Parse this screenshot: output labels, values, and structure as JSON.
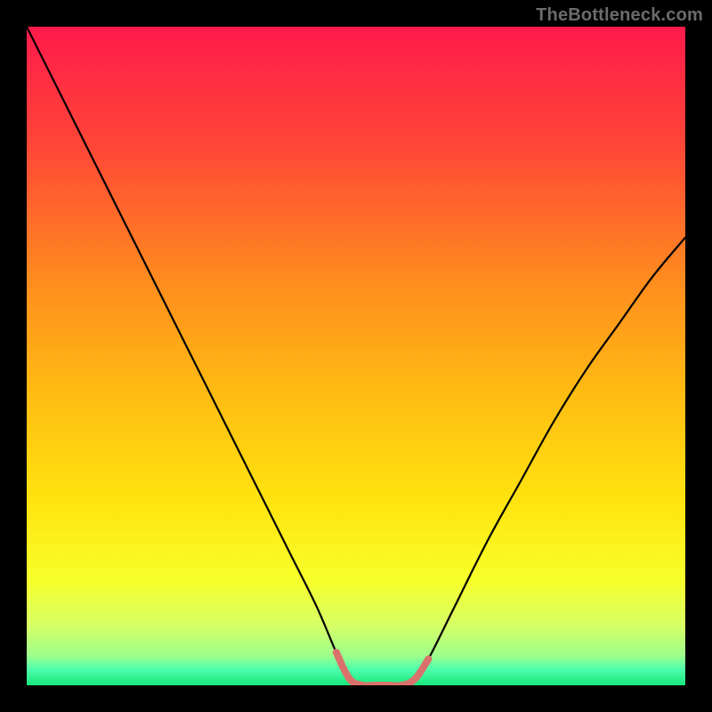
{
  "watermark": "TheBottleneck.com",
  "chart_data": {
    "type": "line",
    "title": "",
    "xlabel": "",
    "ylabel": "",
    "xlim": [
      0,
      100
    ],
    "ylim": [
      0,
      100
    ],
    "grid": false,
    "legend": false,
    "background_gradient": [
      {
        "stop": 0.0,
        "color": "#ff1a4b"
      },
      {
        "stop": 0.18,
        "color": "#ff4637"
      },
      {
        "stop": 0.38,
        "color": "#ff8a1f"
      },
      {
        "stop": 0.55,
        "color": "#ffba12"
      },
      {
        "stop": 0.72,
        "color": "#ffe30f"
      },
      {
        "stop": 0.84,
        "color": "#f7ff2a"
      },
      {
        "stop": 0.91,
        "color": "#d6ff66"
      },
      {
        "stop": 0.955,
        "color": "#9dff8c"
      },
      {
        "stop": 0.975,
        "color": "#4fffad"
      },
      {
        "stop": 1.0,
        "color": "#17e77b"
      }
    ],
    "series": [
      {
        "name": "bottleneck-curve",
        "stroke": "#000000",
        "x": [
          0,
          4,
          8,
          12,
          16,
          20,
          24,
          28,
          32,
          36,
          40,
          44,
          47,
          49,
          51,
          53,
          55,
          57,
          59,
          61,
          65,
          70,
          75,
          80,
          85,
          90,
          95,
          100
        ],
        "y": [
          100,
          92,
          84,
          76,
          68,
          60,
          52,
          44,
          36,
          28,
          20,
          12,
          5,
          1,
          0,
          0,
          0,
          0,
          1,
          4,
          12,
          22,
          31,
          40,
          48,
          55,
          62,
          68
        ]
      },
      {
        "name": "bottom-highlight",
        "stroke": "#d9726b",
        "stroke_width": 8,
        "x": [
          47,
          49,
          51,
          53,
          55,
          57,
          59,
          61
        ],
        "y": [
          5,
          1,
          0,
          0,
          0,
          0,
          1,
          4
        ]
      }
    ]
  }
}
